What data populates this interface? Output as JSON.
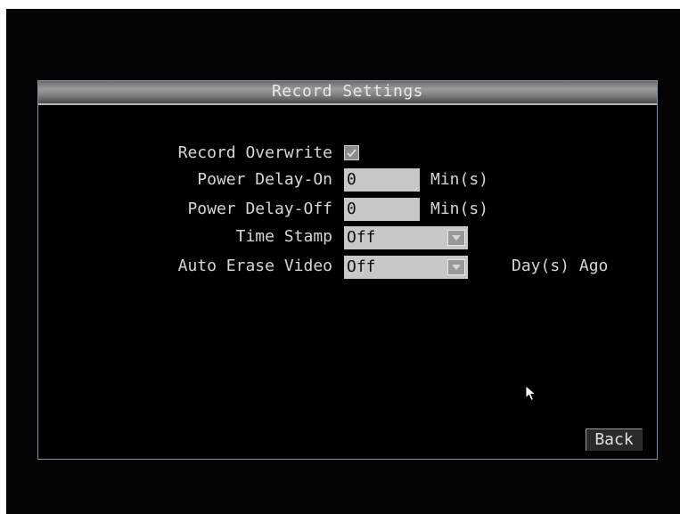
{
  "dialog": {
    "title": "Record Settings"
  },
  "settings": {
    "record_overwrite": {
      "label": "Record Overwrite",
      "checked": true
    },
    "power_delay_on": {
      "label": "Power Delay-On",
      "value": "0",
      "unit": "Min(s)"
    },
    "power_delay_off": {
      "label": "Power Delay-Off",
      "value": "0",
      "unit": "Min(s)"
    },
    "time_stamp": {
      "label": "Time Stamp",
      "value": "Off"
    },
    "auto_erase_video": {
      "label": "Auto Erase Video",
      "value": "Off",
      "unit": "Day(s) Ago"
    }
  },
  "buttons": {
    "back_label": "Back"
  },
  "icons": {
    "checkbox_check": "check-icon",
    "dropdown_arrow": "chevron-down-icon",
    "pointer": "mouse-pointer-icon"
  },
  "colors": {
    "background": "#000000",
    "text": "#d6d6d6",
    "field_background": "#c8c8c8",
    "dialog_border": "#7f8fa8"
  }
}
